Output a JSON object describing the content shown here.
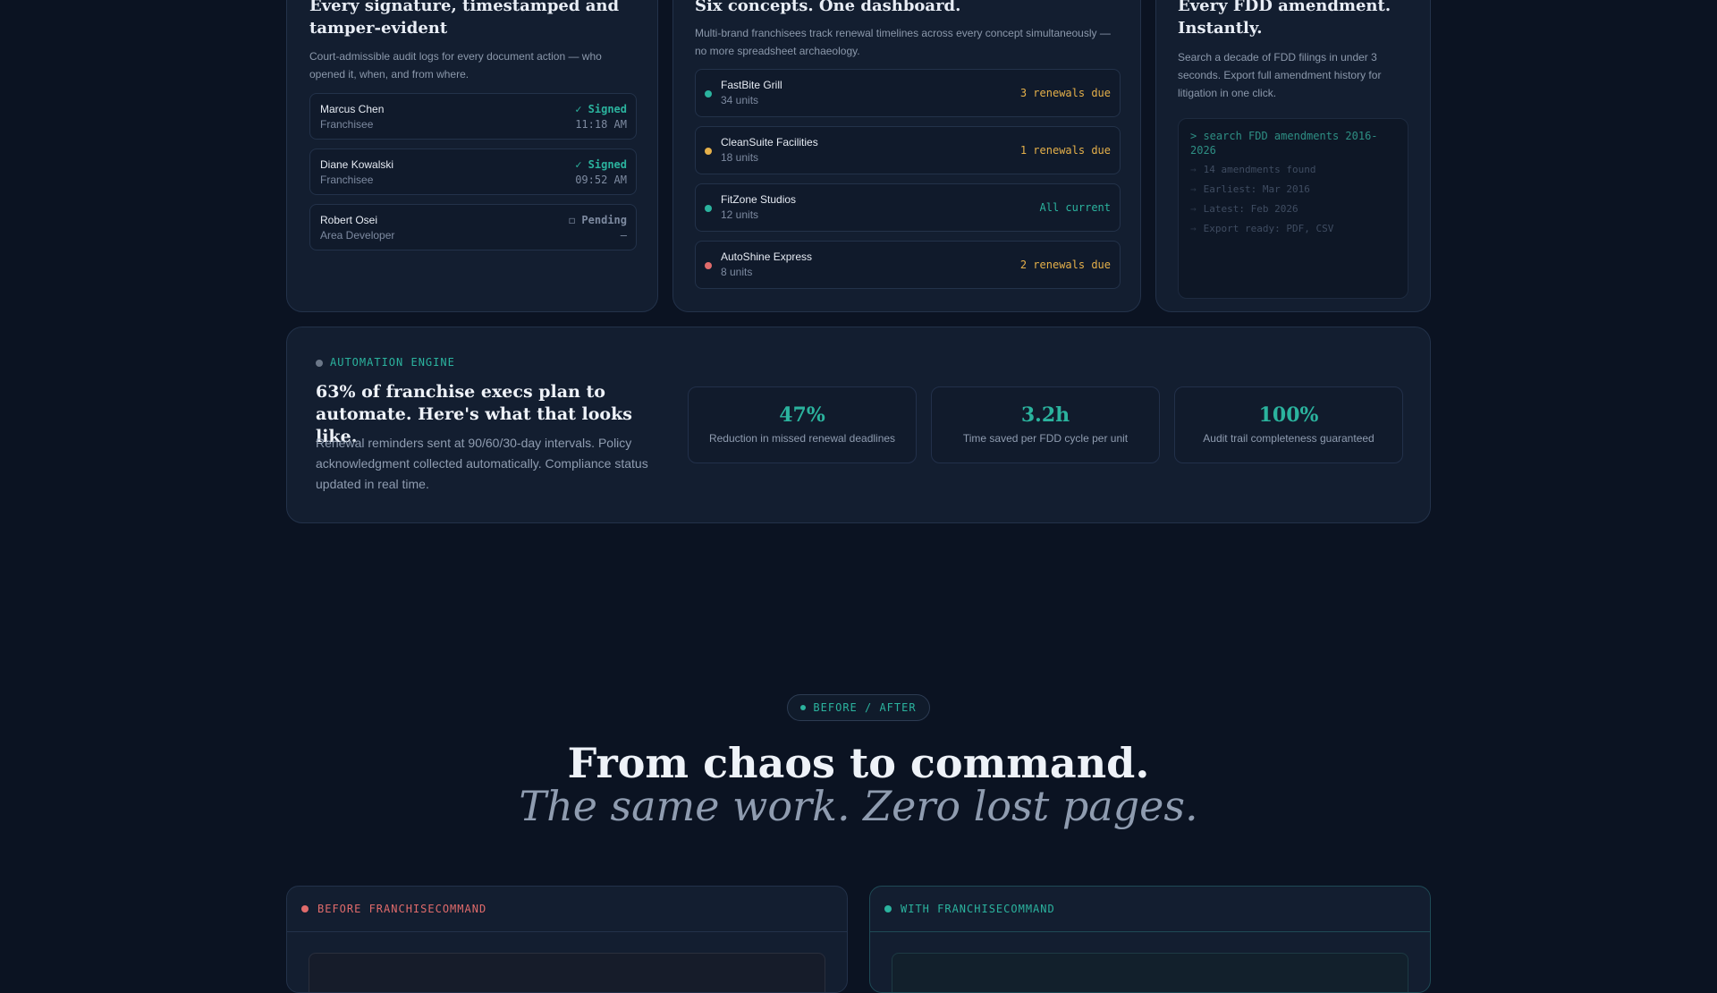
{
  "colors": {
    "teal": "#2bb39e",
    "amber": "#e5b04a",
    "red": "#e06b6b",
    "muted": "#7d8aa0"
  },
  "signatures_card": {
    "title": "Every signature, timestamped and tamper-evident",
    "description": "Court-admissible audit logs for every document action — who opened it, when, and from where.",
    "rows": [
      {
        "name": "Marcus Chen",
        "role": "Franchisee",
        "status": "✓ Signed",
        "time": "11:18 AM",
        "state": "signed"
      },
      {
        "name": "Diane Kowalski",
        "role": "Franchisee",
        "status": "✓ Signed",
        "time": "09:52 AM",
        "state": "signed"
      },
      {
        "name": "Robert Osei",
        "role": "Area Developer",
        "status": "◻ Pending",
        "time": "—",
        "state": "pending"
      }
    ]
  },
  "concepts_card": {
    "title": "Six concepts. One dashboard.",
    "description": "Multi-brand franchisees track renewal timelines across every concept simultaneously — no more spreadsheet archaeology.",
    "rows": [
      {
        "name": "FastBite Grill",
        "units": "34 units",
        "status": "3 renewals due",
        "dot": "teal",
        "status_color": "amber"
      },
      {
        "name": "CleanSuite Facilities",
        "units": "18 units",
        "status": "1 renewals due",
        "dot": "amber",
        "status_color": "amber"
      },
      {
        "name": "FitZone Studios",
        "units": "12 units",
        "status": "All current",
        "dot": "teal",
        "status_color": "teal"
      },
      {
        "name": "AutoShine Express",
        "units": "8 units",
        "status": "2 renewals due",
        "dot": "red",
        "status_color": "amber"
      }
    ]
  },
  "fdd_card": {
    "title": "Every FDD amendment. Instantly.",
    "description": "Search a decade of FDD filings in under 3 seconds. Export full amendment history for litigation in one click.",
    "terminal": {
      "command": "> search FDD amendments 2016-2026",
      "lines": [
        "14 amendments found",
        "Earliest: Mar 2016",
        "Latest: Feb 2026",
        "Export ready: PDF, CSV"
      ]
    }
  },
  "automation": {
    "eyebrow": "AUTOMATION ENGINE",
    "title": "63% of franchise execs plan to automate. Here's what that looks like.",
    "description": "Renewal reminders sent at 90/60/30-day intervals. Policy acknowledgment collected automatically. Compliance status updated in real time.",
    "stats": [
      {
        "value": "47%",
        "label": "Reduction in missed renewal deadlines"
      },
      {
        "value": "3.2h",
        "label": "Time saved per FDD cycle per unit"
      },
      {
        "value": "100%",
        "label": "Audit trail completeness guaranteed"
      }
    ]
  },
  "before_after": {
    "pill": "BEFORE / AFTER",
    "headline": "From chaos to command.",
    "subheadline": "The same work. Zero lost pages.",
    "before_label": "BEFORE FRANCHISECOMMAND",
    "with_label": "WITH FRANCHISECOMMAND"
  }
}
